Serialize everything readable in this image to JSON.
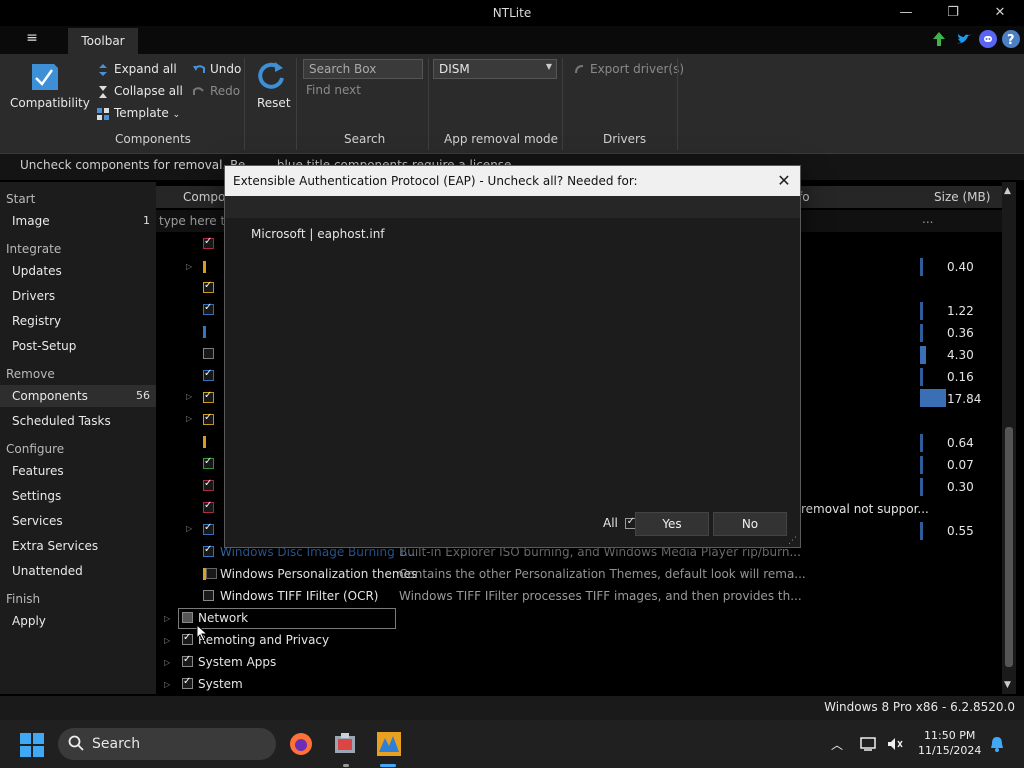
{
  "window": {
    "title": "NTLite",
    "minimize_glyph": "—",
    "restore_glyph": "❐",
    "close_glyph": "✕"
  },
  "ribbon": {
    "menu_glyph": "≡",
    "tab": "Toolbar",
    "compatibility": "Compatibility",
    "expand_all": "Expand all",
    "collapse_all": "Collapse all",
    "template": "Template",
    "undo": "Undo",
    "redo": "Redo",
    "reset": "Reset",
    "components_label": "Components",
    "search_placeholder": "Search Box",
    "find_next": "Find next",
    "search_label": "Search",
    "app_removal_mode": "DISM",
    "app_removal_label": "App removal mode",
    "export_drivers": "Export driver(s)",
    "drivers_label": "Drivers"
  },
  "infobar": {
    "text": "Uncheck components for removal. Re… … blue title components require a license."
  },
  "sidebar": {
    "start": "Start",
    "image": "Image",
    "image_count": "1",
    "integrate": "Integrate",
    "updates": "Updates",
    "drivers": "Drivers",
    "registry": "Registry",
    "post_setup": "Post-Setup",
    "remove": "Remove",
    "components": "Components",
    "components_count": "56",
    "scheduled_tasks": "Scheduled Tasks",
    "configure": "Configure",
    "features": "Features",
    "settings": "Settings",
    "services": "Services",
    "extra_services": "Extra Services",
    "unattended": "Unattended",
    "finish": "Finish",
    "apply": "Apply"
  },
  "table": {
    "col_component": "Compo",
    "col_info": "fo",
    "col_size": "Size (MB)",
    "filter_placeholder": "type here to",
    "filter_size_ellipsis": "...",
    "sizes": [
      "0.40",
      "1.22",
      "0.36",
      "4.30",
      "0.16",
      "17.84",
      "0.64",
      "0.07",
      "0.30",
      "0.55"
    ],
    "partial_desc": "removal not suppor...",
    "rows": [
      {
        "label": "Windows Disc Image Burning T...",
        "desc": "Built-in Explorer ISO burning, and Windows Media Player rip/burn..."
      },
      {
        "label": "Windows Personalization themes",
        "desc": "Contains the other Personalization Themes, default look will rema..."
      },
      {
        "label": "Windows TIFF IFilter (OCR)",
        "desc": "Windows TIFF IFilter processes TIFF images, and then provides th..."
      }
    ],
    "groups": [
      "Network",
      "Remoting and Privacy",
      "System Apps",
      "System"
    ]
  },
  "statusbar": {
    "text": "Windows 8 Pro x86 - 6.2.8520.0"
  },
  "taskbar": {
    "search": "Search",
    "time": "11:50 PM",
    "date": "11/15/2024"
  },
  "dialog": {
    "title": "Extensible Authentication Protocol (EAP) - Uncheck all? Needed for:",
    "close_glyph": "✕",
    "item": "Microsoft  |  eaphost.inf",
    "all_label": "All",
    "yes": "Yes",
    "no": "No"
  },
  "colors": {
    "accent_blue": "#2f6fb5",
    "checkbox_red": "#b03048",
    "checkbox_yellow": "#d9a520",
    "checkbox_blue": "#3a78c8",
    "checkbox_green": "#3aa040"
  }
}
